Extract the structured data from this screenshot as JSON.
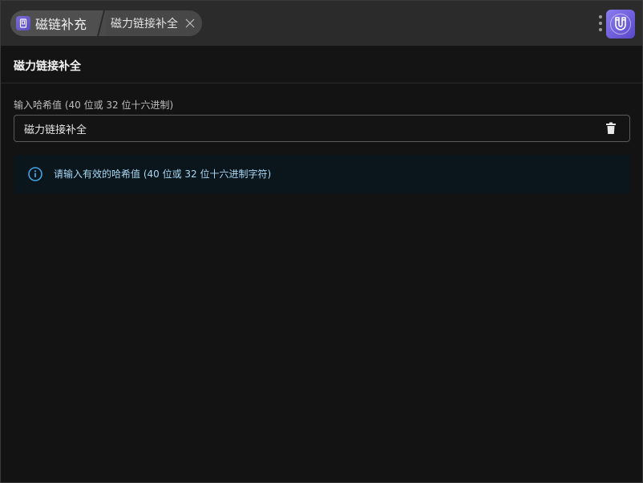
{
  "titlebar": {
    "app_label": "磁链补充",
    "current_page": "磁力链接补全"
  },
  "header": {
    "title": "磁力链接补全"
  },
  "form": {
    "hash_label": "输入哈希值 (40 位或 32 位十六进制)",
    "hash_value": "磁力链接补全",
    "hash_placeholder": ""
  },
  "alert": {
    "message": "请输入有效的哈希值 (40 位或 32 位十六进制字符)"
  },
  "colors": {
    "accent": "#7a6ad6",
    "info": "#3da4e6",
    "info_text": "#a9d8f5"
  },
  "icons": [
    "app-icon",
    "close-icon",
    "more-vertical-icon",
    "magnet-logo-icon",
    "trash-icon",
    "info-icon"
  ]
}
